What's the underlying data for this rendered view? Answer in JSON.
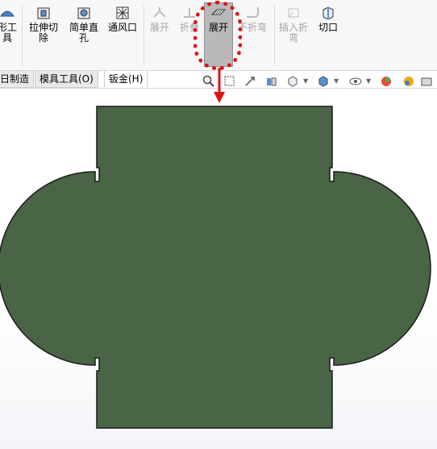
{
  "ribbon": {
    "buttons": [
      {
        "id": "btn-formtool",
        "label": "形工\n具",
        "icon": "forming-tool-icon",
        "enabled": true
      },
      {
        "id": "btn-extrudecut",
        "label": "拉伸切\n除",
        "icon": "extruded-cut-icon",
        "enabled": true
      },
      {
        "id": "btn-simplehole",
        "label": "简单直\n孔",
        "icon": "simple-hole-icon",
        "enabled": true
      },
      {
        "id": "btn-vent",
        "label": "通风口",
        "icon": "vent-icon",
        "enabled": true
      },
      {
        "id": "btn-unfold",
        "label": "展开",
        "icon": "unfold-icon",
        "enabled": false
      },
      {
        "id": "btn-fold",
        "label": "折叠",
        "icon": "fold-icon",
        "enabled": false
      },
      {
        "id": "btn-flatten",
        "label": "展开",
        "icon": "flatten-icon",
        "enabled": true,
        "active": true
      },
      {
        "id": "btn-nobends",
        "label": "不折弯",
        "icon": "no-bends-icon",
        "enabled": false
      },
      {
        "id": "btn-insertbends",
        "label": "插入折\n弯",
        "icon": "insert-bends-icon",
        "enabled": false
      },
      {
        "id": "btn-rip",
        "label": "切口",
        "icon": "rip-icon",
        "enabled": true
      }
    ]
  },
  "tabs": [
    {
      "label": "日制造"
    },
    {
      "label": "模具工具(O)"
    },
    {
      "label": "钣金(H)",
      "active": true
    }
  ],
  "viewbar_icons": [
    "zoom-to-fit-icon",
    "zoom-area-icon",
    "previous-view-icon",
    "section-view-icon",
    "view-orientation-icon",
    "display-style-icon",
    "hide-show-icon",
    "edit-appearance-icon",
    "apply-scene-icon",
    "view-settings-icon"
  ],
  "colors": {
    "part_fill": "#4a6446",
    "part_edge": "#1a1a1a",
    "highlight": "#e01010",
    "active_button": "#b9b9b9"
  }
}
